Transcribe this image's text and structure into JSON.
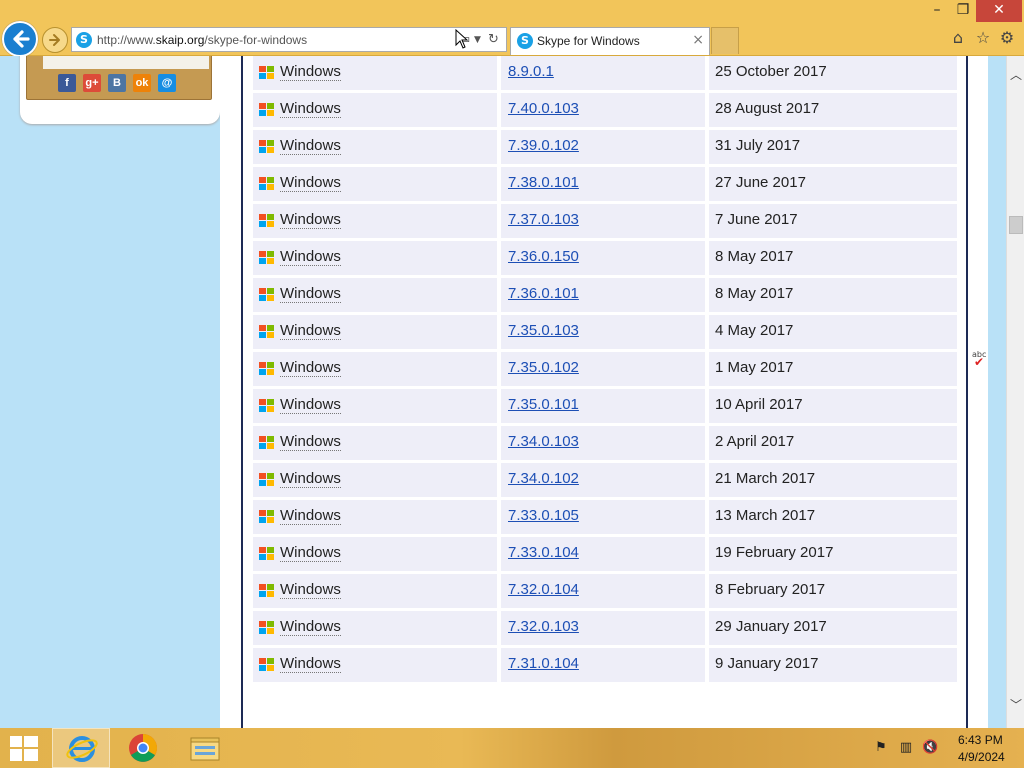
{
  "browser": {
    "url_prefix": "http://www.",
    "url_domain": "skaip.org",
    "url_path": "/skype-for-windows",
    "tab_title": "Skype for Windows",
    "favicon_letter": "S"
  },
  "social": [
    "f",
    "g+",
    "B",
    "ok",
    "@"
  ],
  "table": {
    "rows": [
      {
        "os": "Windows",
        "version": "8.9.0.1",
        "date": "25 October 2017"
      },
      {
        "os": "Windows",
        "version": "7.40.0.103",
        "date": "28 August 2017"
      },
      {
        "os": "Windows",
        "version": "7.39.0.102",
        "date": "31 July 2017"
      },
      {
        "os": "Windows",
        "version": "7.38.0.101",
        "date": "27 June 2017"
      },
      {
        "os": "Windows",
        "version": "7.37.0.103",
        "date": "7 June 2017"
      },
      {
        "os": "Windows",
        "version": "7.36.0.150",
        "date": "8 May 2017"
      },
      {
        "os": "Windows",
        "version": "7.36.0.101",
        "date": "8 May 2017"
      },
      {
        "os": "Windows",
        "version": "7.35.0.103",
        "date": "4 May 2017"
      },
      {
        "os": "Windows",
        "version": "7.35.0.102",
        "date": "1 May 2017"
      },
      {
        "os": "Windows",
        "version": "7.35.0.101",
        "date": "10 April 2017"
      },
      {
        "os": "Windows",
        "version": "7.34.0.103",
        "date": "2 April 2017"
      },
      {
        "os": "Windows",
        "version": "7.34.0.102",
        "date": "21 March 2017"
      },
      {
        "os": "Windows",
        "version": "7.33.0.105",
        "date": "13 March 2017"
      },
      {
        "os": "Windows",
        "version": "7.33.0.104",
        "date": "19 February 2017"
      },
      {
        "os": "Windows",
        "version": "7.32.0.104",
        "date": "8 February 2017"
      },
      {
        "os": "Windows",
        "version": "7.32.0.103",
        "date": "29 January 2017"
      },
      {
        "os": "Windows",
        "version": "7.31.0.104",
        "date": "9 January 2017"
      }
    ]
  },
  "spellcheck_label": "abc",
  "taskbar": {
    "time": "6:43 PM",
    "date": "4/9/2024"
  },
  "colors": {
    "page_bg": "#b9e1f7",
    "cell_bg": "#eeeef8",
    "link": "#1d4fb5",
    "chrome_bar": "#f2c55a"
  }
}
